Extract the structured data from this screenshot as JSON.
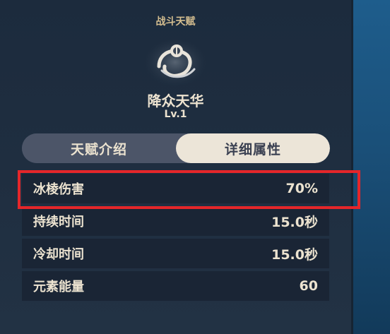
{
  "talent": {
    "category": "战斗天赋",
    "name": "降众天华",
    "level": "Lv.1",
    "emblem_icon": "ice-lotus-talent-icon"
  },
  "tabs": [
    {
      "label": "天赋介绍",
      "active": false
    },
    {
      "label": "详细属性",
      "active": true
    }
  ],
  "attributes": [
    {
      "name": "冰棱伤害",
      "value": "70%"
    },
    {
      "name": "持续时间",
      "value": "15.0秒"
    },
    {
      "name": "冷却时间",
      "value": "15.0秒"
    },
    {
      "name": "元素能量",
      "value": "60"
    }
  ],
  "colors": {
    "panel_bg": "#1f2e40",
    "row_bg": "#1a2535",
    "gold_text": "#d3bd8f",
    "light_text": "#ece3d0",
    "tab_active_bg": "#ece5d8",
    "tab_inactive_bg": "#4c5568",
    "highlight_red": "#e5262a"
  }
}
